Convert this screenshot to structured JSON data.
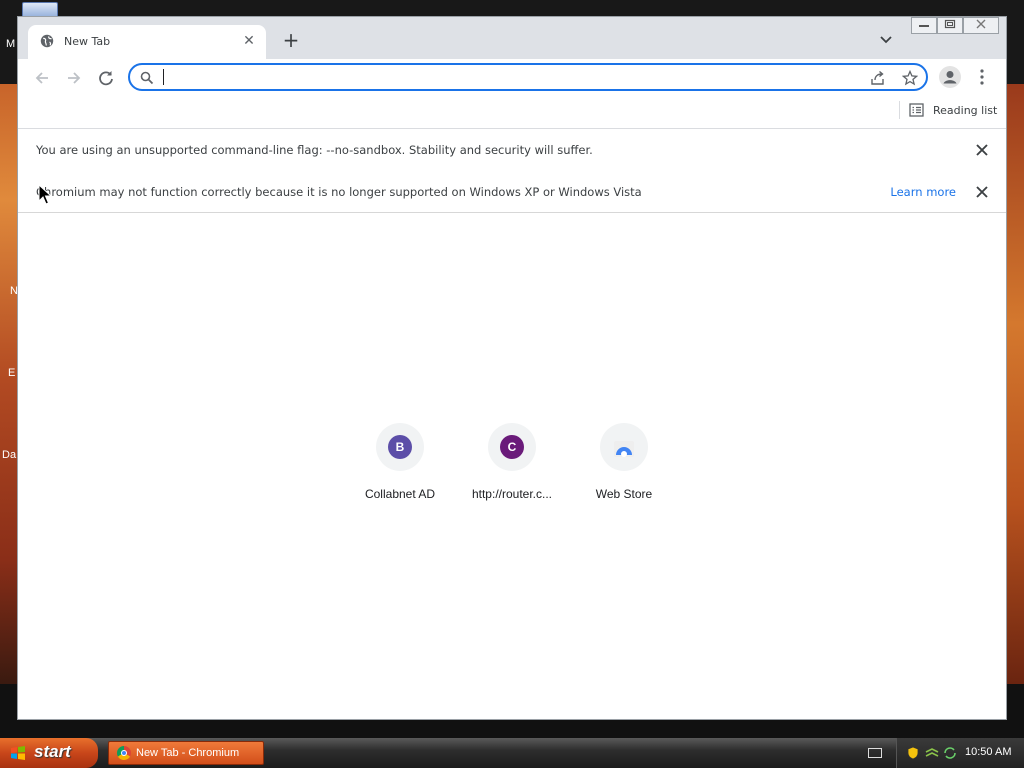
{
  "window": {
    "tab_title": "New Tab",
    "new_tab_symbol": "+",
    "close_symbol": "✕"
  },
  "omnibox": {
    "value": "",
    "placeholder": ""
  },
  "bookmarks_bar": {
    "reading_list_label": "Reading list"
  },
  "infobars": [
    {
      "message": "You are using an unsupported command-line flag: --no-sandbox. Stability and security will suffer."
    },
    {
      "message": "Chromium may not function correctly because it is no longer supported on Windows XP or Windows Vista",
      "link": "Learn more"
    }
  ],
  "shortcuts": [
    {
      "letter": "B",
      "title": "Collabnet AD",
      "color": "#5c4ea8"
    },
    {
      "letter": "C",
      "title": "http://router.c...",
      "color": "#6a1b7a"
    },
    {
      "letter": "",
      "title": "Web Store",
      "color": "#4285f4"
    }
  ],
  "taskbar": {
    "start_label": "start",
    "task_label": "New Tab - Chromium",
    "clock": "10:50 AM"
  },
  "desktop": {
    "fragments": [
      "M",
      "N",
      "E",
      "Da"
    ]
  },
  "icons": {
    "favicon": "globe-icon",
    "back": "arrow-left-icon",
    "forward": "arrow-right-icon",
    "reload": "reload-icon",
    "search": "search-icon",
    "share": "share-icon",
    "bookmark": "star-icon",
    "profile": "person-icon",
    "menu": "kebab-menu-icon",
    "reading_list": "list-icon",
    "tab_search": "chevron-down-icon"
  },
  "colors": {
    "accent": "#1a73e8",
    "tabstrip": "#dee1e6",
    "link": "#1a73e8"
  }
}
